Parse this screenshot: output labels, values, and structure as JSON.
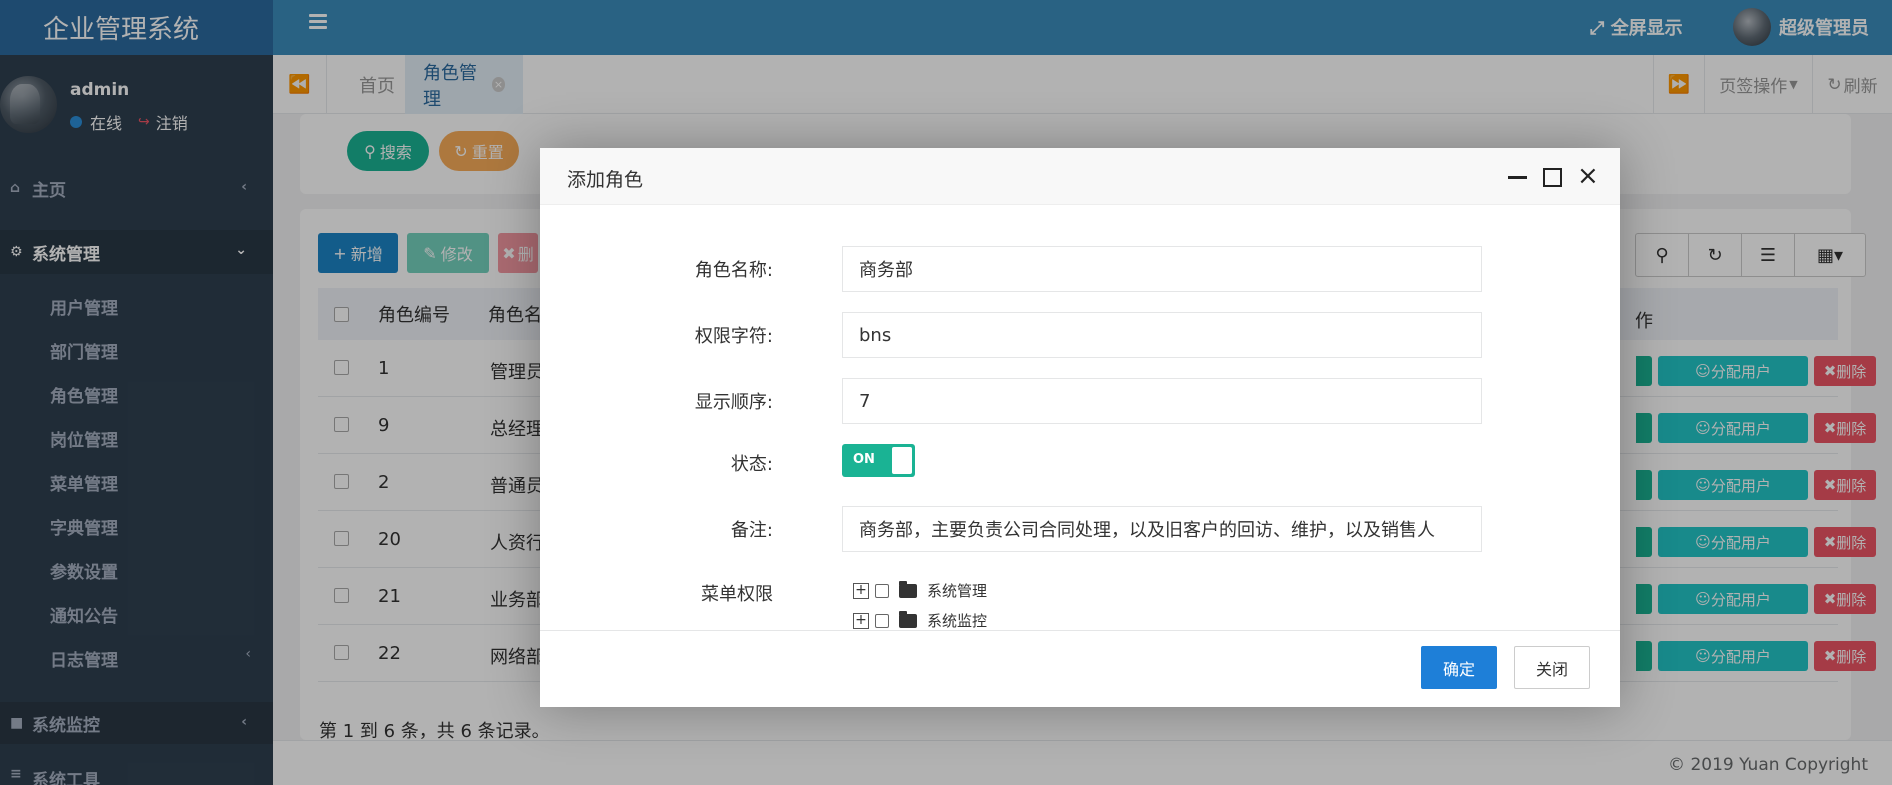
{
  "app": {
    "brand": "企业管理系统"
  },
  "user": {
    "name": "admin",
    "status": "在线",
    "logout": "注销"
  },
  "topbar": {
    "fullscreen": "全屏显示",
    "admin_name": "超级管理员"
  },
  "sidebar": {
    "home": "主页",
    "system": "系统管理",
    "sub_items": [
      "用户管理",
      "部门管理",
      "角色管理",
      "岗位管理",
      "菜单管理",
      "字典管理",
      "参数设置",
      "通知公告",
      "日志管理"
    ],
    "monitor": "系统监控",
    "tools": "系统工具"
  },
  "tabs": {
    "home": "首页",
    "role": "角色管理",
    "ops": "页签操作",
    "refresh": "刷新"
  },
  "search": {
    "search_btn": "搜索",
    "reset_btn": "重置"
  },
  "toolbar": {
    "add": "新增",
    "edit": "修改",
    "del": "删"
  },
  "table": {
    "headers": {
      "id": "角色编号",
      "name": "角色名",
      "op": "作"
    },
    "rows": [
      {
        "id": "1",
        "name": "管理员"
      },
      {
        "id": "9",
        "name": "总经理"
      },
      {
        "id": "2",
        "name": "普通员"
      },
      {
        "id": "20",
        "name": "人资行"
      },
      {
        "id": "21",
        "name": "业务部"
      },
      {
        "id": "22",
        "name": "网络部"
      }
    ],
    "assign_label": "分配用户",
    "delete_label": "删除",
    "pager": "第 1 到 6 条，共 6 条记录。"
  },
  "footer": {
    "copyright": "© 2019 Yuan Copyright"
  },
  "modal": {
    "title": "添加角色",
    "fields": {
      "role_name": {
        "label": "角色名称:",
        "value": "商务部"
      },
      "perm_key": {
        "label": "权限字符:",
        "value": "bns"
      },
      "order": {
        "label": "显示顺序:",
        "value": "7"
      },
      "status": {
        "label": "状态:",
        "value": "ON"
      },
      "remark": {
        "label": "备注:",
        "value": "商务部，主要负责公司合同处理，以及旧客户的回访、维护，以及销售人"
      },
      "menu_perm": {
        "label": "菜单权限"
      }
    },
    "tree": [
      "系统管理",
      "系统监控"
    ],
    "ok": "确定",
    "cancel": "关闭"
  },
  "colors": {
    "topbar": "#3c8dbc",
    "sidebar": "#2f4050",
    "primary": "#1c84c6",
    "success": "#1ab394",
    "danger": "#ed5565",
    "info": "#23c6c8",
    "warning": "#f8ac59"
  }
}
